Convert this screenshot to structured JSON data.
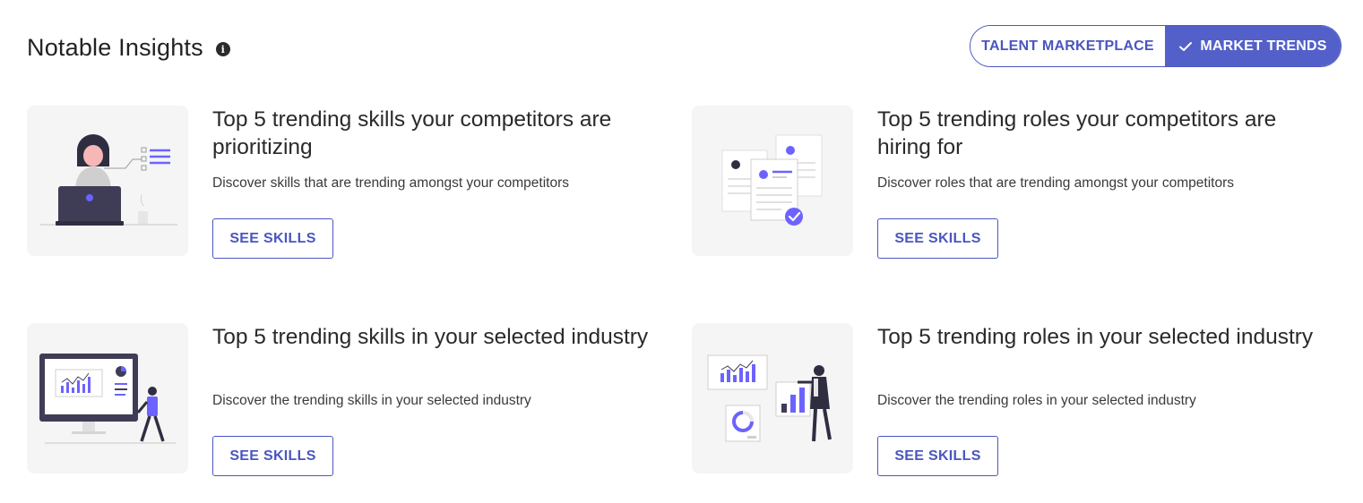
{
  "header": {
    "title": "Notable Insights",
    "info_icon": "info-icon"
  },
  "toggle": {
    "options": [
      {
        "label": "TALENT MARKETPLACE",
        "selected": false
      },
      {
        "label": "MARKET TRENDS",
        "selected": true,
        "icon": "check-icon"
      }
    ],
    "accent": "#5360c9"
  },
  "cards": [
    {
      "title": "Top 5 trending skills your competitors are prioritizing",
      "description": "Discover skills that are trending amongst your competitors",
      "button": "SEE SKILLS",
      "illustration": "person-at-laptop-illustration"
    },
    {
      "title": "Top 5 trending roles your competitors are hiring for",
      "description": "Discover roles that are trending amongst your competitors",
      "button": "SEE SKILLS",
      "illustration": "resumes-illustration"
    },
    {
      "title": "Top 5 trending skills in your selected industry",
      "description": "Discover the trending skills in your selected industry",
      "button": "SEE SKILLS",
      "illustration": "monitor-chart-illustration"
    },
    {
      "title": "Top 5 trending roles in your selected industry",
      "description": "Discover the trending roles in your selected industry",
      "button": "SEE SKILLS",
      "illustration": "person-presenting-charts-illustration"
    }
  ]
}
